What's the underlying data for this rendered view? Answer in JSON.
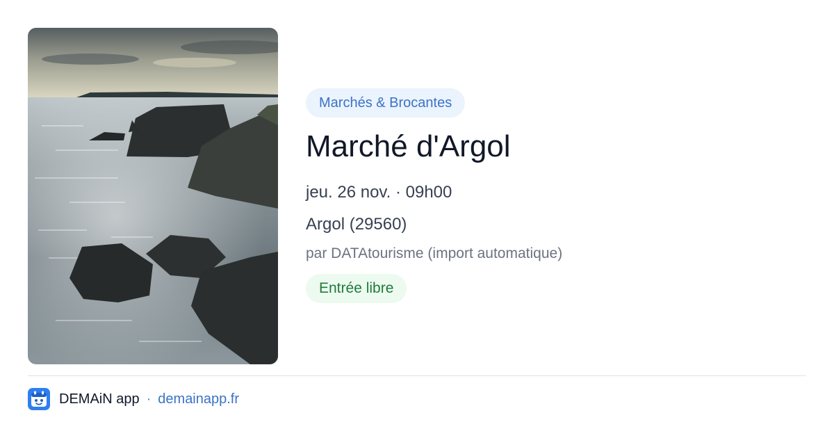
{
  "event": {
    "category": "Marchés & Brocantes",
    "title": "Marché d'Argol",
    "date_time": "jeu. 26 nov. · 09h00",
    "location": "Argol (29560)",
    "source": "par DATAtourisme (import automatique)",
    "price": "Entrée libre",
    "photo_icon": "coastal-photo"
  },
  "footer": {
    "app_name": "DEMAiN app",
    "separator": "·",
    "site": "demainapp.fr",
    "logo_icon": "calendar-face-icon"
  },
  "colors": {
    "category_bg": "#ebf3fd",
    "category_text": "#3b73c6",
    "price_bg": "#ecfaf0",
    "price_text": "#207a3a",
    "link": "#3b73c6",
    "logo_bg": "#2f7ef0"
  }
}
